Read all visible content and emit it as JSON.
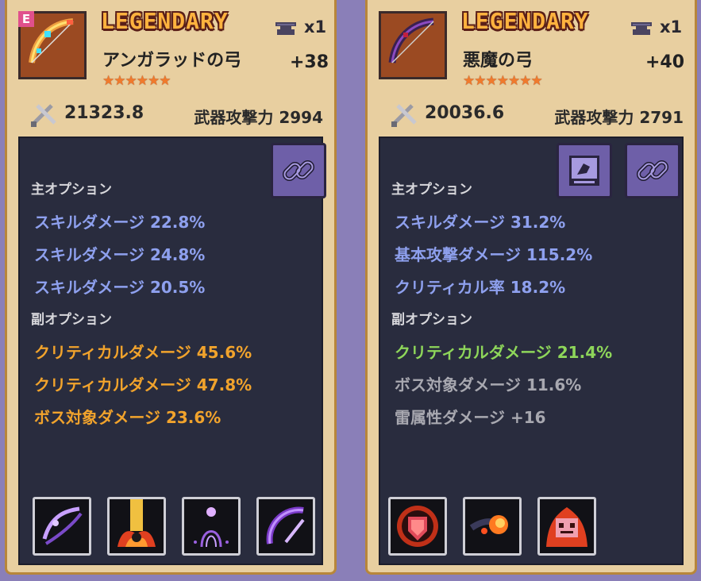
{
  "cards": [
    {
      "e_badge": "E",
      "rarity": "LEGENDARY",
      "count": "x1",
      "name": "アンガラッドの弓",
      "enhance": "+38",
      "stars": "★★★★★★",
      "power": "21323.8",
      "weapon_attack_label": "武器攻撃力",
      "weapon_attack": "2994",
      "main_header": "主オプション",
      "main_options": [
        "スキルダメージ  22.8%",
        "スキルダメージ  24.8%",
        "スキルダメージ  20.5%"
      ],
      "sub_header": "副オプション",
      "sub_options": [
        "クリティカルダメージ  45.6%",
        "クリティカルダメージ  47.8%",
        "ボス対象ダメージ  23.6%"
      ],
      "icons": [
        "link-icon"
      ],
      "skill_icons": [
        "bow-spirit-icon",
        "fire-pillar-icon",
        "spirit-orb-icon",
        "crescent-blade-icon"
      ]
    },
    {
      "rarity": "LEGENDARY",
      "count": "x1",
      "name": "悪魔の弓",
      "enhance": "+40",
      "stars": "★★★★★★★",
      "power": "20036.6",
      "weapon_attack_label": "武器攻撃力",
      "weapon_attack": "2791",
      "main_header": "主オプション",
      "main_options": [
        "スキルダメージ  31.2%",
        "基本攻撃ダメージ  115.2%",
        "クリティカル率  18.2%"
      ],
      "sub_header": "副オプション",
      "sub_options": [
        "クリティカルダメージ  21.4%",
        "ボス対象ダメージ  11.6%",
        "雷属性ダメージ  +16"
      ],
      "icons": [
        "skill-book-icon",
        "link-icon"
      ],
      "skill_icons": [
        "shield-burst-icon",
        "fireball-icon",
        "burning-robot-icon"
      ]
    }
  ],
  "colors": {
    "blue_option": "#8ea0ee",
    "orange_option": "#f1a32c",
    "green_option": "#8ed65a",
    "gray_option": "#a8a8b0",
    "rarity": "#ffb23e"
  }
}
